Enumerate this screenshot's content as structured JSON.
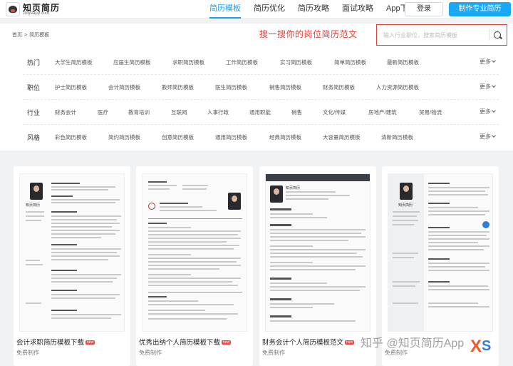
{
  "brand": {
    "title": "知页简历",
    "subtitle": "zhiyeapp.com"
  },
  "nav": [
    {
      "label": "简历模板",
      "active": true
    },
    {
      "label": "简历优化",
      "active": false
    },
    {
      "label": "简历攻略",
      "active": false
    },
    {
      "label": "面试攻略",
      "active": false
    },
    {
      "label": "App下载",
      "active": false
    }
  ],
  "header": {
    "login_label": "登录",
    "make_label": "制作专业简历"
  },
  "breadcrumb": {
    "home": "首页",
    "sep": ">",
    "current": "简历模板"
  },
  "promo": "搜一搜你的岗位简历范文",
  "search": {
    "placeholder": "输入行业职位，搜索简历模板"
  },
  "filters": [
    {
      "label": "热门",
      "items": [
        "大学生简历模板",
        "应届生简历模板",
        "求职简历模板",
        "工作简历模板",
        "实习简历模板",
        "简单简历模板",
        "最新简历模板"
      ],
      "more": "更多"
    },
    {
      "label": "职位",
      "items": [
        "护士简历模板",
        "会计简历模板",
        "教师简历模板",
        "医生简历模板",
        "销售简历模板",
        "财务简历模板",
        "人力资源简历模板"
      ],
      "more": "更多"
    },
    {
      "label": "行业",
      "items": [
        "财务会计",
        "医疗",
        "教育培训",
        "互联网",
        "人事行政",
        "通用职能",
        "销售",
        "文化/传媒",
        "房地产/建筑",
        "贸易/物流"
      ],
      "more": "更多"
    },
    {
      "label": "风格",
      "items": [
        "彩色简历模板",
        "简约简历模板",
        "创意简历模板",
        "通用简历模板",
        "经典简历模板",
        "大容量简历模板",
        "清新简历模板"
      ],
      "more": "更多"
    }
  ],
  "cards": [
    {
      "title": "会计求职简历模板下载",
      "badge": "new",
      "sub": "免费制作",
      "resume_name": "知页简历"
    },
    {
      "title": "优秀出纳个人简历模板下载",
      "badge": "new",
      "sub": "免费制作",
      "resume_name": "知页简历"
    },
    {
      "title": "财务会计个人简历模板范文",
      "badge": "new",
      "sub": "免费制作",
      "resume_name": "知页简历"
    },
    {
      "title": "",
      "badge": "",
      "sub": "免费制作",
      "resume_name": "知页简历"
    }
  ],
  "watermark": "知乎 @知页简历App",
  "colors": {
    "accent": "#1a9ff0",
    "primary_button": "#19a8f5",
    "promo_red": "#e0403a"
  }
}
